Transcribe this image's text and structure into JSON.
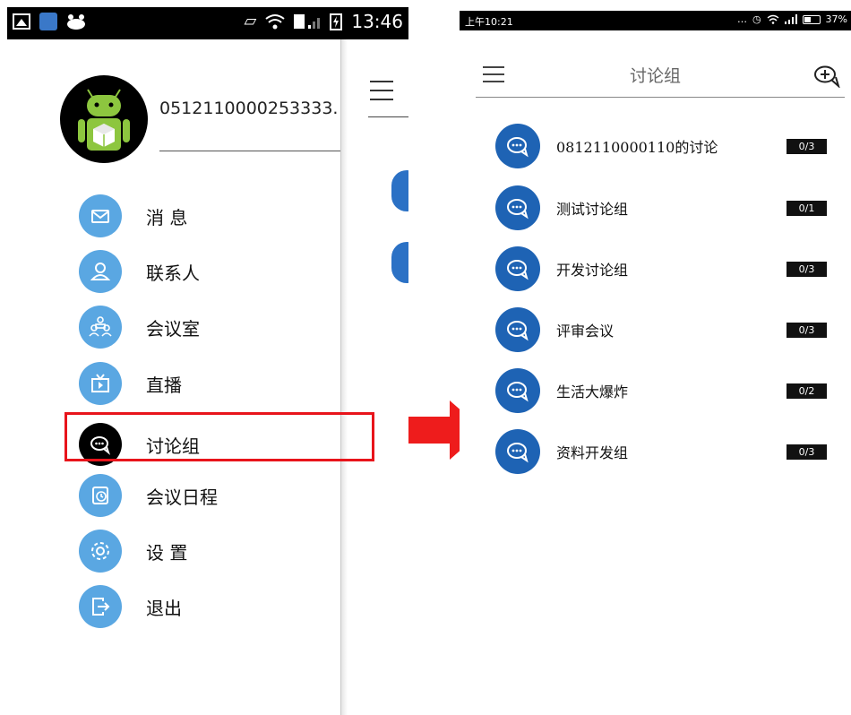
{
  "left_screen": {
    "status_bar": {
      "time": "13:46"
    },
    "account_id": "0512110000253333.",
    "menu": [
      {
        "label": "消 息",
        "icon": "mail-icon"
      },
      {
        "label": "联系人",
        "icon": "contact-icon"
      },
      {
        "label": "会议室",
        "icon": "meeting-room-icon"
      },
      {
        "label": "直播",
        "icon": "live-tv-icon"
      },
      {
        "label": "讨论组",
        "icon": "chat-bubble-icon",
        "highlighted": true
      },
      {
        "label": "会议日程",
        "icon": "schedule-icon"
      },
      {
        "label": "设 置",
        "icon": "settings-gear-icon"
      },
      {
        "label": "退出",
        "icon": "logout-icon"
      }
    ]
  },
  "right_screen": {
    "status_bar": {
      "time": "上午10:21",
      "battery": "37%"
    },
    "header": {
      "title": "讨论组"
    },
    "groups": [
      {
        "name": "0812110000110的讨论",
        "count": "0/3"
      },
      {
        "name": "测试讨论组",
        "count": "0/1"
      },
      {
        "name": "开发讨论组",
        "count": "0/3"
      },
      {
        "name": "评审会议",
        "count": "0/3"
      },
      {
        "name": "生活大爆炸",
        "count": "0/2"
      },
      {
        "name": "资料开发组",
        "count": "0/3"
      }
    ]
  },
  "colors": {
    "menu_icon": "#5aa7e2",
    "menu_icon_active": "#000000",
    "group_icon": "#1e63b4",
    "highlight": "#e8141b",
    "arrow": "#ee1c1c"
  }
}
